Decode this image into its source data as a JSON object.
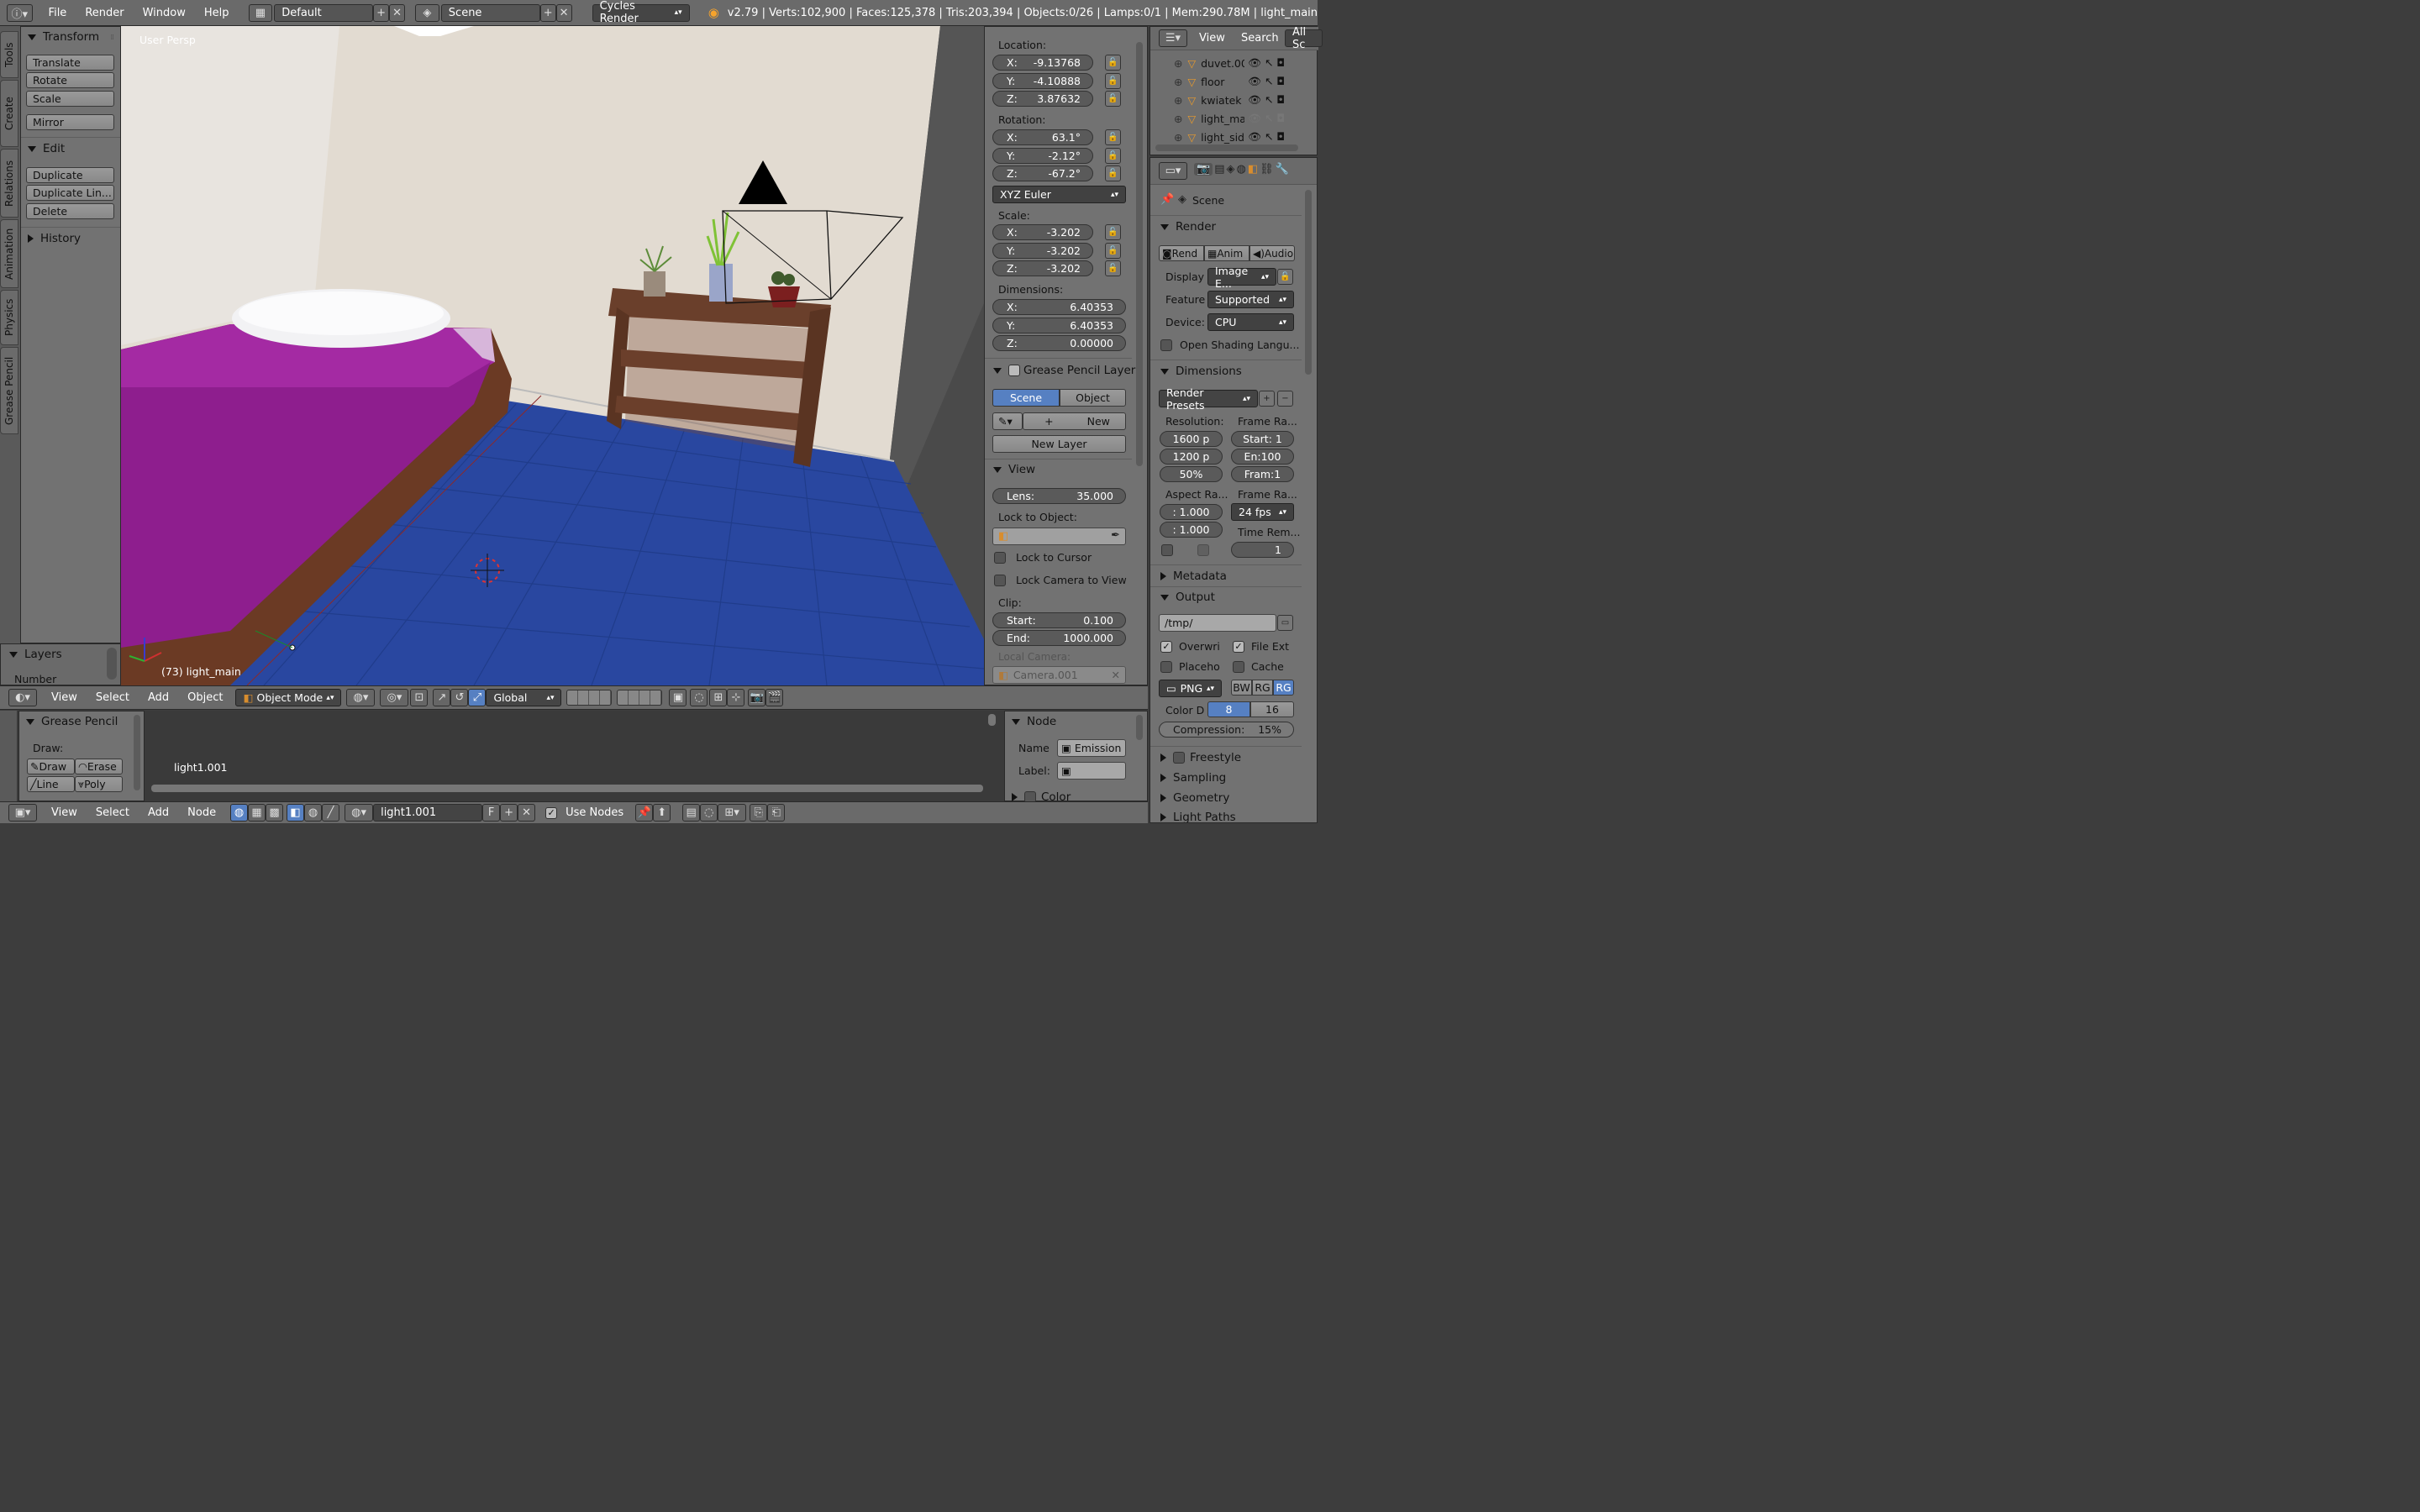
{
  "topbar": {
    "menus": [
      "File",
      "Render",
      "Window",
      "Help"
    ],
    "layout": "Default",
    "scene": "Scene",
    "engine": "Cycles Render",
    "stats": "v2.79 | Verts:102,900 | Faces:125,378 | Tris:203,394 | Objects:0/26 | Lamps:0/1 | Mem:290.78M | light_main"
  },
  "tools": {
    "tabs": [
      "Tools",
      "Create",
      "Relations",
      "Animation",
      "Physics",
      "Grease Pencil"
    ],
    "transform_header": "Transform",
    "transform_buttons": [
      "Translate",
      "Rotate",
      "Scale"
    ],
    "mirror": "Mirror",
    "edit_header": "Edit",
    "edit_buttons": [
      "Duplicate",
      "Duplicate Lin...",
      "Delete"
    ],
    "history_header": "History",
    "layers_header": "Layers",
    "number_label": "Number"
  },
  "viewport": {
    "persp_label": "User Persp",
    "object_label": "(73) light_main",
    "menu": [
      "View",
      "Select",
      "Add",
      "Object"
    ],
    "mode": "Object Mode",
    "orientation": "Global"
  },
  "properties_n": {
    "location_label": "Location:",
    "location": {
      "x": "-9.13768",
      "y": "-4.10888",
      "z": "3.87632"
    },
    "rotation_label": "Rotation:",
    "rotation": {
      "x": "63.1°",
      "y": "-2.12°",
      "z": "-67.2°"
    },
    "rotation_mode": "XYZ Euler",
    "scale_label": "Scale:",
    "scale": {
      "x": "-3.202",
      "y": "-3.202",
      "z": "-3.202"
    },
    "dimensions_label": "Dimensions:",
    "dimensions": {
      "x": "6.40353",
      "y": "6.40353",
      "z": "0.00000"
    },
    "gp_layers": "Grease Pencil Layers",
    "scene_btn": "Scene",
    "object_btn": "Object",
    "new_btn": "New",
    "new_layer_btn": "New Layer",
    "view_header": "View",
    "lens": "Lens:",
    "lens_val": "35.000",
    "lock_to_object": "Lock to Object:",
    "lock_to_cursor": "Lock to Cursor",
    "lock_camera": "Lock Camera to View",
    "clip_label": "Clip:",
    "clip_start": "Start:",
    "clip_start_val": "0.100",
    "clip_end": "End:",
    "clip_end_val": "1000.000",
    "local_camera": "Local Camera:",
    "camera_name": "Camera.001"
  },
  "outliner": {
    "view": "View",
    "search": "Search",
    "filter": "All Sc",
    "items": [
      "duvet.00",
      "floor",
      "kwiatek",
      "light_ma",
      "light_sid"
    ]
  },
  "render_props": {
    "scene": "Scene",
    "render_header": "Render",
    "render_btn": "Rend",
    "anim_btn": "Anim",
    "audio_btn": "Audio",
    "display_label": "Display",
    "display_val": "Image E...",
    "feature_label": "Feature",
    "feature_val": "Supported",
    "device_label": "Device:",
    "device_val": "CPU",
    "osl": "Open Shading Langu...",
    "dimensions_header": "Dimensions",
    "presets": "Render Presets",
    "resolution_label": "Resolution:",
    "res_x": "1600 p",
    "res_y": "1200 p",
    "res_pct": "50%",
    "frame_range_label": "Frame Ra...",
    "start": "Start: 1",
    "end": "En:100",
    "frame": "Fram:1",
    "aspect_label": "Aspect Ra...",
    "aspect_x": ": 1.000",
    "aspect_y": ": 1.000",
    "frame_rate_label": "Frame Ra...",
    "fps": "24 fps",
    "time_remap": "Time Rem...",
    "time_val": "1",
    "metadata": "Metadata",
    "output": "Output",
    "path": "/tmp/",
    "overwrite": "Overwri",
    "file_ext": "File Ext",
    "placeholder": "Placeho",
    "cache": "Cache",
    "format": "PNG",
    "bw": "BW",
    "rgb": "RG",
    "rgba": "RG",
    "color_depth": "Color D",
    "depth8": "8",
    "depth16": "16",
    "compression": "Compression:",
    "compression_val": "15%",
    "freestyle": "Freestyle",
    "sampling": "Sampling",
    "geometry": "Geometry",
    "light_paths": "Light Paths"
  },
  "node_editor": {
    "gp_header": "Grease Pencil",
    "draw_label": "Draw:",
    "draw": "Draw",
    "erase": "Erase",
    "line": "Line",
    "poly": "Poly",
    "node_label": "light1.001",
    "node_header": "Node",
    "name_label": "Name",
    "name_val": "Emission",
    "label_label": "Label:",
    "color_header": "Color",
    "menu": [
      "View",
      "Select",
      "Add",
      "Node"
    ],
    "material": "light1.001",
    "use_nodes": "Use Nodes"
  }
}
